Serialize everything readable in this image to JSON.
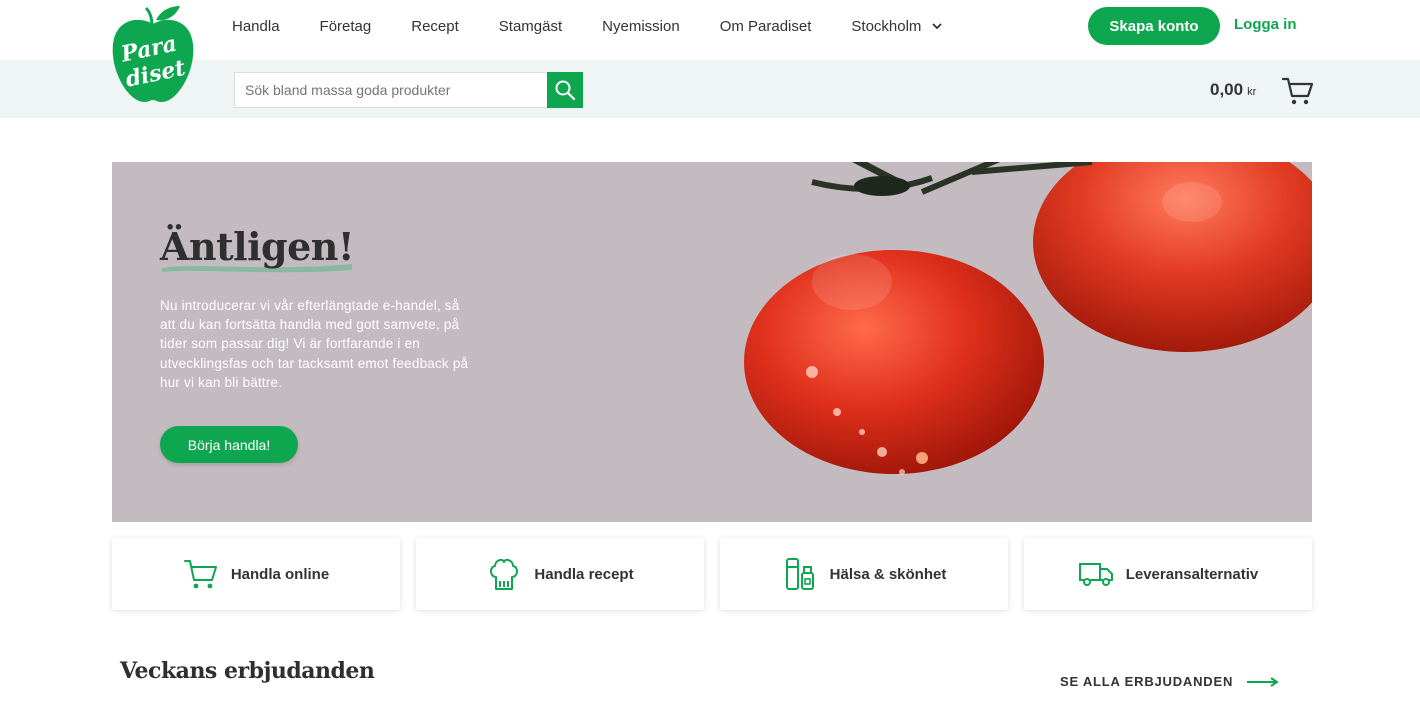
{
  "brand": {
    "logo_text": "Paradiset",
    "accent": "#0fa650"
  },
  "nav": {
    "items": [
      "Handla",
      "Företag",
      "Recept",
      "Stamgäst",
      "Nyemission",
      "Om Paradiset",
      "Stockholm"
    ]
  },
  "header": {
    "create_account": "Skapa konto",
    "login": "Logga in",
    "search_placeholder": "Sök bland massa goda produkter",
    "cart_total": "0,00",
    "cart_currency": "kr"
  },
  "hero": {
    "title": "Äntligen!",
    "text": "Nu introducerar vi vår efterlängtade e-handel, så att du kan fortsätta handla med gott samvete, på tider som passar dig! Vi är fortfarande i en utvecklingsfas och tar tacksamt emot feedback på hur vi kan bli bättre.",
    "cta": "Börja handla!"
  },
  "cards": [
    {
      "label": "Handla online",
      "icon": "cart-icon"
    },
    {
      "label": "Handla recept",
      "icon": "chef-hat-icon"
    },
    {
      "label": "Hälsa & skönhet",
      "icon": "cosmetics-icon"
    },
    {
      "label": "Leveransalternativ",
      "icon": "truck-icon"
    }
  ],
  "offers": {
    "title": "Veckans erbjudanden",
    "see_all": "SE ALLA ERBJUDANDEN"
  }
}
